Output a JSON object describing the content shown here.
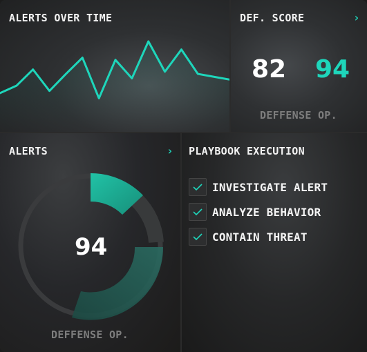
{
  "alerts_over_time": {
    "title": "ALERTS OVER TIME",
    "accent": "#1ed6bb",
    "series": [
      16,
      26,
      48,
      19,
      42,
      64,
      9,
      61,
      36,
      86,
      45,
      75,
      42,
      38,
      34
    ]
  },
  "def_score": {
    "title": "DEF. SCORE",
    "value_primary": "82",
    "value_secondary": "94",
    "caption": "DEFFENSE OP.",
    "chevron": "chevron-right-icon"
  },
  "alerts": {
    "title": "ALERTS",
    "value": "94",
    "caption": "DEFFENSE OP.",
    "chevron": "chevron-right-icon"
  },
  "playbook": {
    "title": "PLAYBOOK EXECUTION",
    "items": [
      {
        "label": "INVESTIGATE ALERT",
        "checked": true
      },
      {
        "label": "ANALYZE BEHAVIOR",
        "checked": true
      },
      {
        "label": "CONTAIN THREAT",
        "checked": true
      }
    ]
  },
  "colors": {
    "accent": "#1ed6bb",
    "accent_dark": "#1f5b52",
    "caption": "#7d7d7d"
  }
}
